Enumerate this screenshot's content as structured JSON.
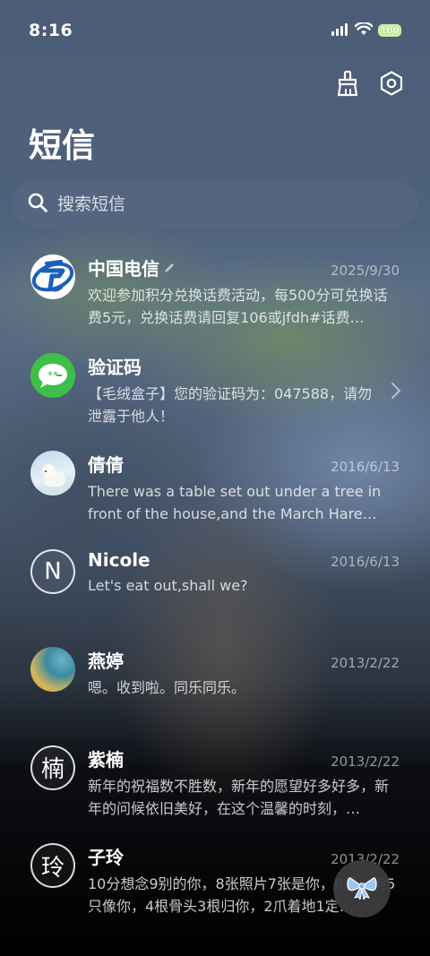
{
  "status": {
    "time": "8:16",
    "battery": "100"
  },
  "page_title": "短信",
  "search": {
    "placeholder": "搜索短信"
  },
  "conversations": [
    {
      "avatar": "china-telecom-logo",
      "name": "中国电信",
      "date": "2025/9/30",
      "preview": "欢迎参加积分兑换话费活动，每500分可兑换话费5元，兑换话费请回复106或jfdh#话费…"
    },
    {
      "avatar": "message-icon",
      "name": "验证码",
      "date": "",
      "preview": "【毛绒盒子】您的验证码为：047588，请勿泄露于他人！"
    },
    {
      "avatar": "polar-bear-photo",
      "name": "倩倩",
      "date": "2016/6/13",
      "preview": "There was a table set out under a tree in front of the house,and the March Hare an…"
    },
    {
      "avatar": "letter",
      "initial": "N",
      "name": "Nicole",
      "date": "2016/6/13",
      "preview": "Let's eat out,shall we?"
    },
    {
      "avatar": "landscape-photo",
      "name": "燕婷",
      "date": "2013/2/22",
      "preview": "嗯。收到啦。同乐同乐。"
    },
    {
      "avatar": "letter",
      "initial": "楠",
      "name": "紫楠",
      "date": "2013/2/22",
      "preview": "新年的祝福数不胜数，新年的愿望好多好多，新年的问候依旧美好，在这个温馨的时刻，…"
    },
    {
      "avatar": "letter",
      "initial": "玲",
      "name": "子玲",
      "date": "2013/2/22",
      "preview": "10分想念9别的你，8张照片7张是你，6只小狗5只像你，4根骨头3根归你，2爪着地1定…"
    }
  ],
  "colors": {
    "telecom_blue": "#1d5fb8",
    "chat_green": "#3fbf4a",
    "fab_bow": "#9cc8ee"
  }
}
